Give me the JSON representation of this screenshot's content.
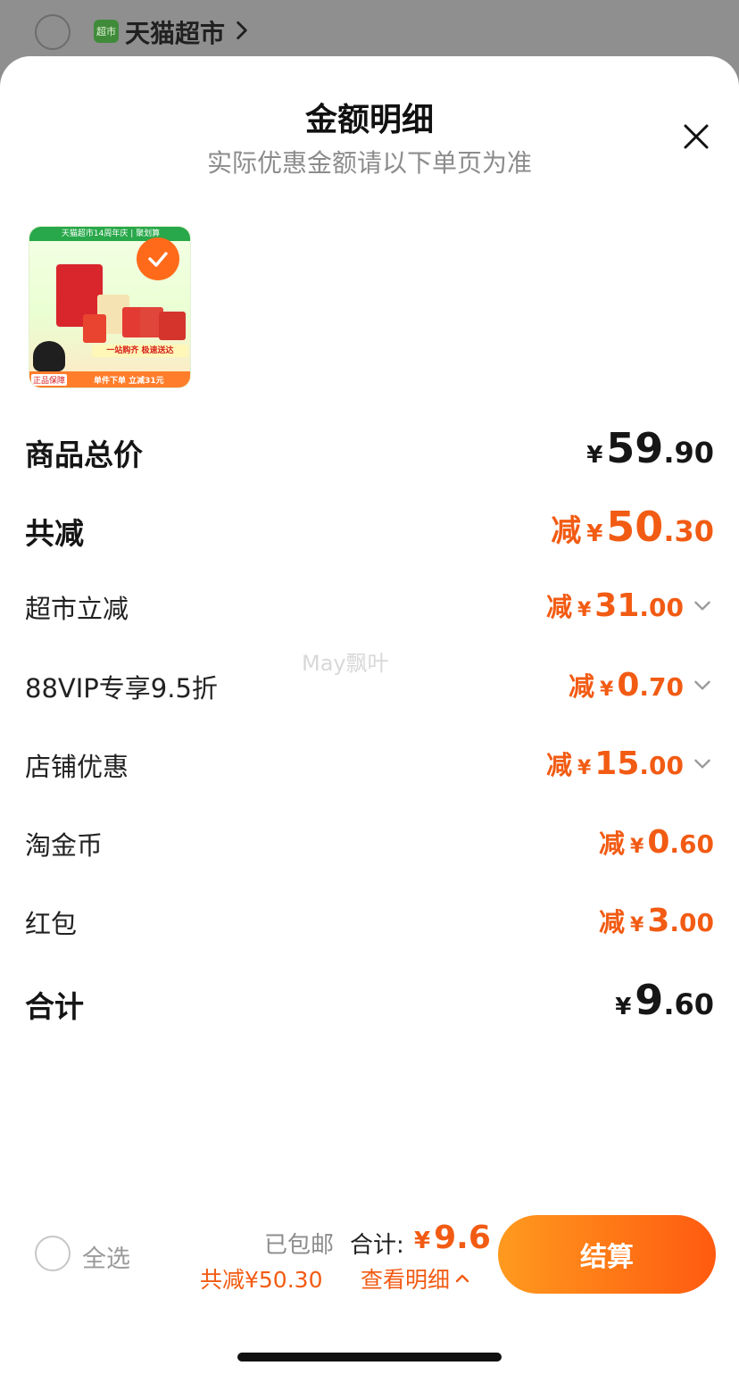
{
  "background": {
    "shop_name": "天猫超市",
    "logo_text": "超市"
  },
  "sheet": {
    "title": "金额明细",
    "subtitle": "实际优惠金额请以下单页为准"
  },
  "product": {
    "banner_text": "天猫超市14周年庆 | 聚划算",
    "strip_text": "一站购齐 极速送达",
    "badge_text": "正品保障",
    "promo_text": "单件下单 立减31元",
    "selected": true
  },
  "rows": [
    {
      "label": "商品总价",
      "prefix": "",
      "yen": "¥",
      "int": "59",
      "dec": ".90",
      "bold": true,
      "color": "dark",
      "chevron": false
    },
    {
      "label": "共减",
      "prefix": "减",
      "yen": "¥",
      "int": "50",
      "dec": ".30",
      "bold": true,
      "color": "orange",
      "chevron": false
    },
    {
      "label": "超市立减",
      "prefix": "减",
      "yen": "¥",
      "int": "31",
      "dec": ".00",
      "bold": false,
      "color": "orange",
      "chevron": true
    },
    {
      "label": "88VIP专享9.5折",
      "prefix": "减",
      "yen": "¥",
      "int": "0",
      "dec": ".70",
      "bold": false,
      "color": "orange",
      "chevron": true
    },
    {
      "label": "店铺优惠",
      "prefix": "减",
      "yen": "¥",
      "int": "15",
      "dec": ".00",
      "bold": false,
      "color": "orange",
      "chevron": true
    },
    {
      "label": "淘金币",
      "prefix": "减",
      "yen": "¥",
      "int": "0",
      "dec": ".60",
      "bold": false,
      "color": "orange",
      "chevron": false
    },
    {
      "label": "红包",
      "prefix": "减",
      "yen": "¥",
      "int": "3",
      "dec": ".00",
      "bold": false,
      "color": "orange",
      "chevron": false
    },
    {
      "label": "合计",
      "prefix": "",
      "yen": "¥",
      "int": "9",
      "dec": ".60",
      "bold": true,
      "color": "dark",
      "chevron": false
    }
  ],
  "watermark": "May飘叶",
  "footer": {
    "select_all": "全选",
    "shipping": "已包邮",
    "total_label": "合计:",
    "total_yen": "¥",
    "total_value": "9.6",
    "savings": "共减¥50.30",
    "detail_link": "查看明细",
    "checkout": "结算"
  },
  "colors": {
    "accent": "#f25b13",
    "checkout_start": "#ff9a1e",
    "checkout_end": "#ff5a10"
  }
}
